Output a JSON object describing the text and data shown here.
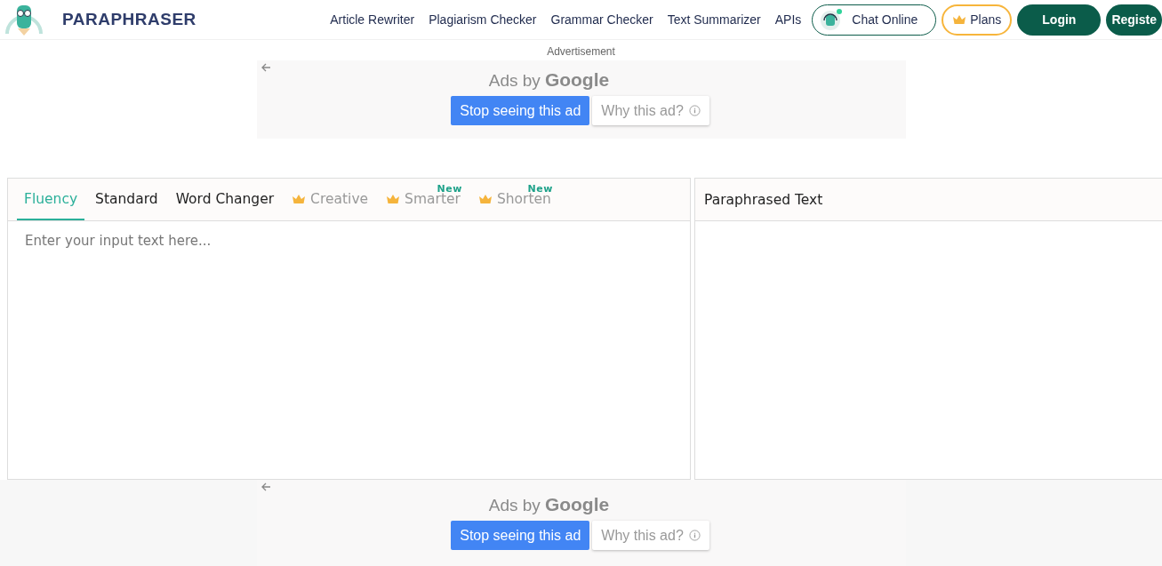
{
  "header": {
    "brand": "PARAPHRASER",
    "nav": [
      "Article Rewriter",
      "Plagiarism Checker",
      "Grammar Checker",
      "Text Summarizer",
      "APIs"
    ],
    "chat": "Chat Online",
    "plans": "Plans",
    "login": "Login",
    "register": "Registe"
  },
  "top_ad": {
    "label": "Advertisement",
    "ads_by": "Ads by",
    "google": "Google",
    "stop": "Stop seeing this ad",
    "why": "Why this ad?"
  },
  "editor": {
    "tabs": [
      {
        "label": "Fluency",
        "kind": "free",
        "selected": true
      },
      {
        "label": "Standard",
        "kind": "free",
        "selected": false
      },
      {
        "label": "Word Changer",
        "kind": "free",
        "selected": false
      },
      {
        "label": "Creative",
        "kind": "premium",
        "selected": false
      },
      {
        "label": "Smarter",
        "kind": "premium",
        "badge": "New",
        "selected": false
      },
      {
        "label": "Shorten",
        "kind": "premium",
        "badge": "New",
        "selected": false
      }
    ],
    "placeholder": "Enter your input text here...",
    "output_title": "Paraphrased Text"
  },
  "bottom_ad": {
    "ads_by": "Ads by",
    "google": "Google",
    "stop": "Stop seeing this ad",
    "why": "Why this ad?"
  }
}
